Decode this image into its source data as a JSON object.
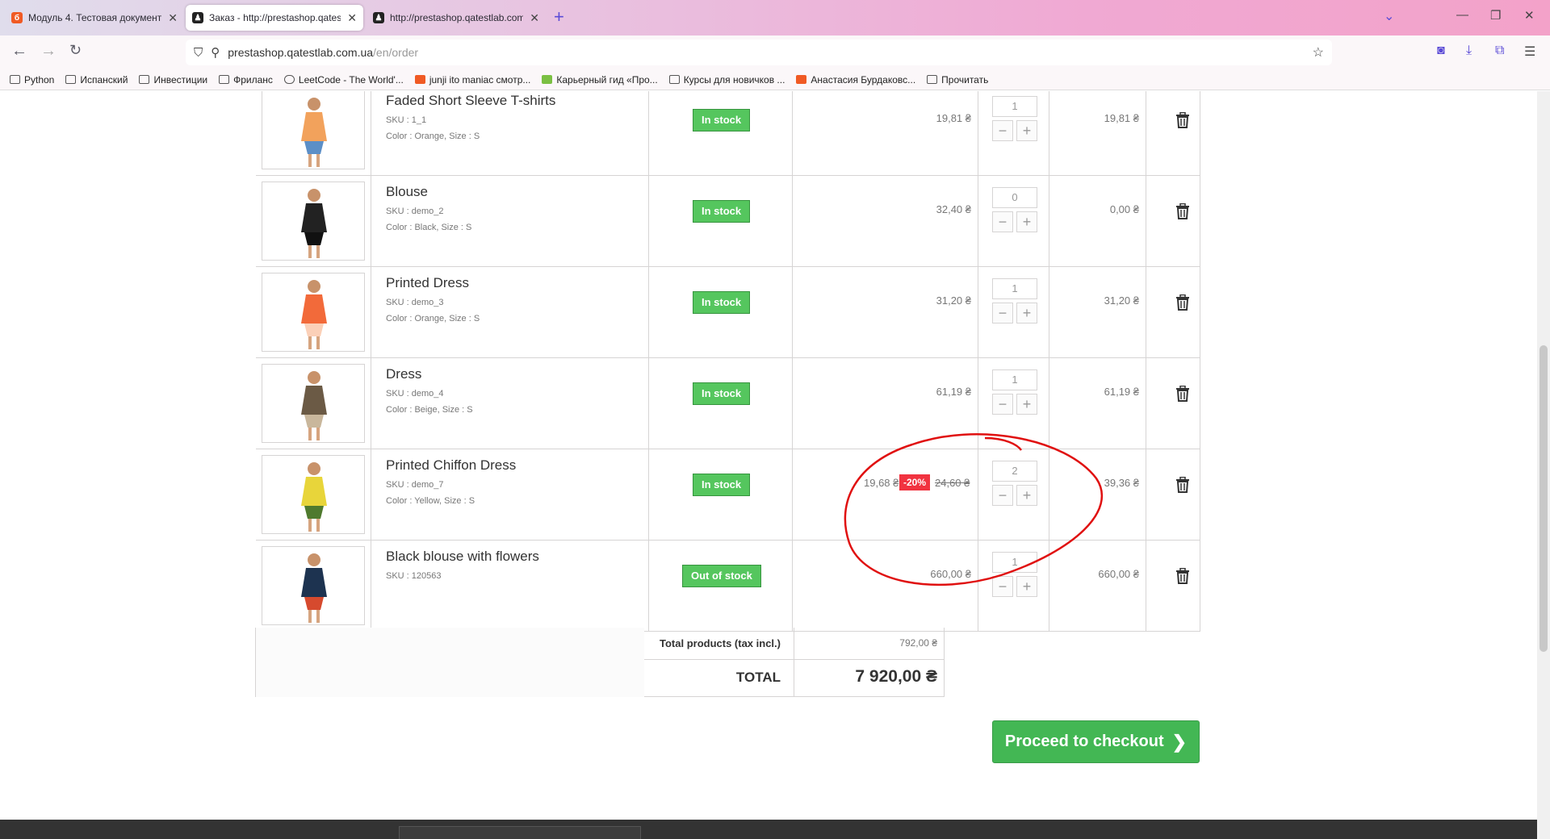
{
  "browser": {
    "tabs": [
      {
        "title": "Модуль 4. Тестовая документа",
        "active": false
      },
      {
        "title": "Заказ - http://prestashop.qates",
        "active": true
      },
      {
        "title": "http://prestashop.qatestlab.com",
        "active": false
      }
    ],
    "url_host": "prestashop.qatestlab.com.ua",
    "url_path": "/en/order",
    "bookmarks": [
      "Python",
      "Испанский",
      "Инвестиции",
      "Фриланс",
      "LeetCode - The World'...",
      "junji ito maniac смотр...",
      "Карьерный гид «Про...",
      "Курсы для новичков ...",
      "Анастасия Бурдаковс...",
      "Прочитать"
    ]
  },
  "cart": {
    "rows": [
      {
        "name": "Faded Short Sleeve T-shirts",
        "sku": "SKU : 1_1",
        "attrs": "Color : Orange, Size : S",
        "stock": "In stock",
        "unit_price": "19,81 ₴",
        "qty": "1",
        "total": "19,81 ₴"
      },
      {
        "name": "Blouse",
        "sku": "SKU : demo_2",
        "attrs": "Color : Black, Size : S",
        "stock": "In stock",
        "unit_price": "32,40 ₴",
        "qty": "0",
        "total": "0,00 ₴"
      },
      {
        "name": "Printed Dress",
        "sku": "SKU : demo_3",
        "attrs": "Color : Orange, Size : S",
        "stock": "In stock",
        "unit_price": "31,20 ₴",
        "qty": "1",
        "total": "31,20 ₴"
      },
      {
        "name": "Dress",
        "sku": "SKU : demo_4",
        "attrs": "Color : Beige, Size : S",
        "stock": "In stock",
        "unit_price": "61,19 ₴",
        "qty": "1",
        "total": "61,19 ₴"
      },
      {
        "name": "Printed Chiffon Dress",
        "sku": "SKU : demo_7",
        "attrs": "Color : Yellow, Size : S",
        "stock": "In stock",
        "unit_price": "19,68 ₴",
        "discount": "-20%",
        "old_price": "24,60 ₴",
        "qty": "2",
        "total": "39,36 ₴"
      },
      {
        "name": "Black blouse with flowers",
        "sku": "SKU : 120563",
        "attrs": "",
        "stock": "Out of stock",
        "unit_price": "660,00 ₴",
        "qty": "1",
        "total": "660,00 ₴"
      }
    ],
    "total_products_label": "Total products (tax incl.)",
    "total_products_value": "792,00 ₴",
    "total_label": "TOTAL",
    "total_value": "7 920,00 ₴",
    "checkout_label": "Proceed to checkout",
    "minus": "−",
    "plus": "+"
  },
  "colors": {
    "in_stock": "#55c65e",
    "discount": "#f13340",
    "annotation": "#e01010",
    "checkout": "#43b754"
  }
}
